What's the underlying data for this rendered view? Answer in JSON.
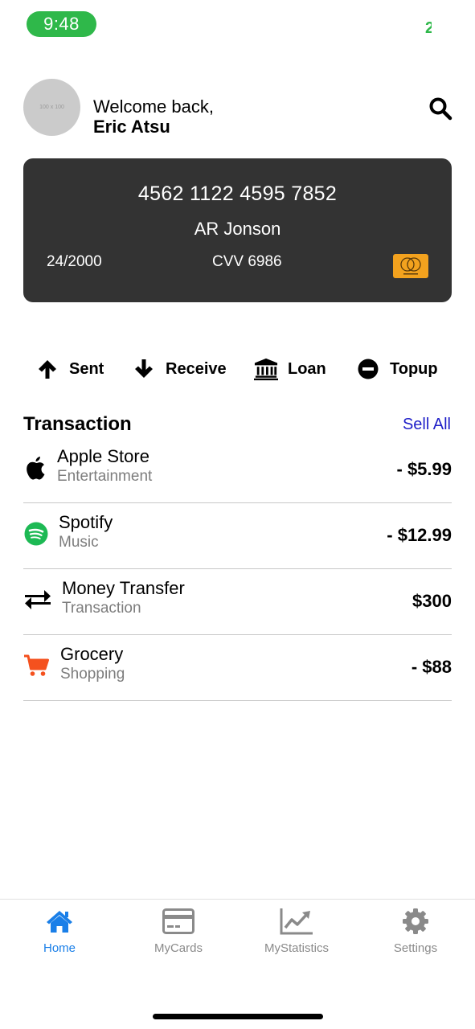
{
  "status": {
    "time": "9:48",
    "right_indicator": "2"
  },
  "header": {
    "avatar_placeholder": "100 x 100",
    "welcome": "Welcome back,",
    "user_name": "Eric Atsu",
    "search_icon": "search-icon"
  },
  "card": {
    "number": "4562 1122 4595 7852",
    "holder": "AR Jonson",
    "expiry": "24/2000",
    "cvv": "CVV 6986",
    "brand": "mastercard",
    "background": "#333333",
    "brand_color": "#f3a21e"
  },
  "actions": [
    {
      "label": "Sent",
      "icon": "arrow-up-icon"
    },
    {
      "label": "Receive",
      "icon": "arrow-down-icon"
    },
    {
      "label": "Loan",
      "icon": "bank-icon"
    },
    {
      "label": "Topup",
      "icon": "minus-circle-icon"
    }
  ],
  "transactions": {
    "title": "Transaction",
    "see_all": "Sell All",
    "items": [
      {
        "name": "Apple Store",
        "category": "Entertainment",
        "amount": "- $5.99",
        "icon": "apple-icon"
      },
      {
        "name": "Spotify",
        "category": "Music",
        "amount": "- $12.99",
        "icon": "spotify-icon",
        "icon_color": "#1db954"
      },
      {
        "name": "Money Transfer",
        "category": "Transaction",
        "amount": "$300",
        "icon": "transfer-icon"
      },
      {
        "name": "Grocery",
        "category": "Shopping",
        "amount": "- $88",
        "icon": "cart-icon",
        "icon_color": "#f4511e"
      }
    ]
  },
  "tabbar": {
    "active_color": "#1a7fe8",
    "tabs": [
      {
        "label": "Home",
        "icon": "home-icon",
        "active": true
      },
      {
        "label": "MyCards",
        "icon": "card-icon",
        "active": false
      },
      {
        "label": "MyStatistics",
        "icon": "chart-icon",
        "active": false
      },
      {
        "label": "Settings",
        "icon": "gear-icon",
        "active": false
      }
    ]
  }
}
